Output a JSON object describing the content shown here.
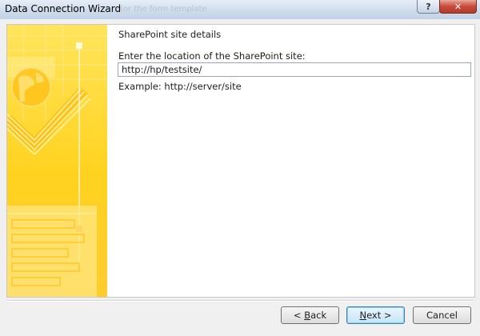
{
  "window": {
    "title": "Data Connection Wizard",
    "ghost_title": "(or the form template",
    "help_glyph": "?",
    "close_glyph": "✕"
  },
  "content": {
    "step_title": "SharePoint site details",
    "location_label": "Enter the location of the SharePoint site:",
    "location_value": "http://hp/testsite/",
    "example_text": "Example: http://server/site"
  },
  "buttons": {
    "back": {
      "prefix": "< ",
      "mnemonic": "B",
      "rest": "ack"
    },
    "next": {
      "mnemonic": "N",
      "rest": "ext >"
    },
    "cancel": "Cancel"
  },
  "colors": {
    "art_yellow": "#ffcc33",
    "art_light": "#ffe47a",
    "accent_blue": "#3c7fb1"
  },
  "icons": [
    "help-icon",
    "close-icon",
    "globe-icon",
    "checkmark-icon"
  ]
}
